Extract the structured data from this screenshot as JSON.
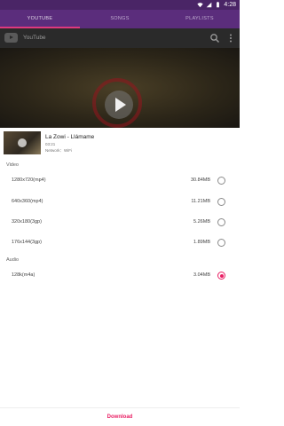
{
  "status_bar": {
    "time": "4:28",
    "icons": [
      "wifi-icon",
      "signal-icon",
      "battery-icon"
    ]
  },
  "tabs": [
    {
      "label": "YOUTUBE",
      "active": true
    },
    {
      "label": "SONGS",
      "active": false
    },
    {
      "label": "PLAYLISTS",
      "active": false
    }
  ],
  "youtube": {
    "title": "YouTube",
    "icons": [
      "youtube-logo-icon",
      "search-icon",
      "more-vert-icon"
    ]
  },
  "video_info": {
    "title": "La Zowi - Llámame",
    "duration": "03:21",
    "network": "Network：WiFi"
  },
  "sections": {
    "video": "Video",
    "audio": "Audio"
  },
  "video_options": [
    {
      "format": "1280x720(mp4)",
      "size": "30.84MB",
      "selected": false
    },
    {
      "format": "640x360(mp4)",
      "size": "11.21MB",
      "selected": false
    },
    {
      "format": "320x180(3gp)",
      "size": "5.26MB",
      "selected": false
    },
    {
      "format": "176x144(3gp)",
      "size": "1.89MB",
      "selected": false
    }
  ],
  "audio_options": [
    {
      "format": "128k(m4a)",
      "size": "3.04MB",
      "selected": true
    }
  ],
  "actions": {
    "download": "Download"
  },
  "colors": {
    "accent": "#e91e63",
    "statusbar": "#4a2566",
    "tabbar": "#5b2d7c"
  }
}
